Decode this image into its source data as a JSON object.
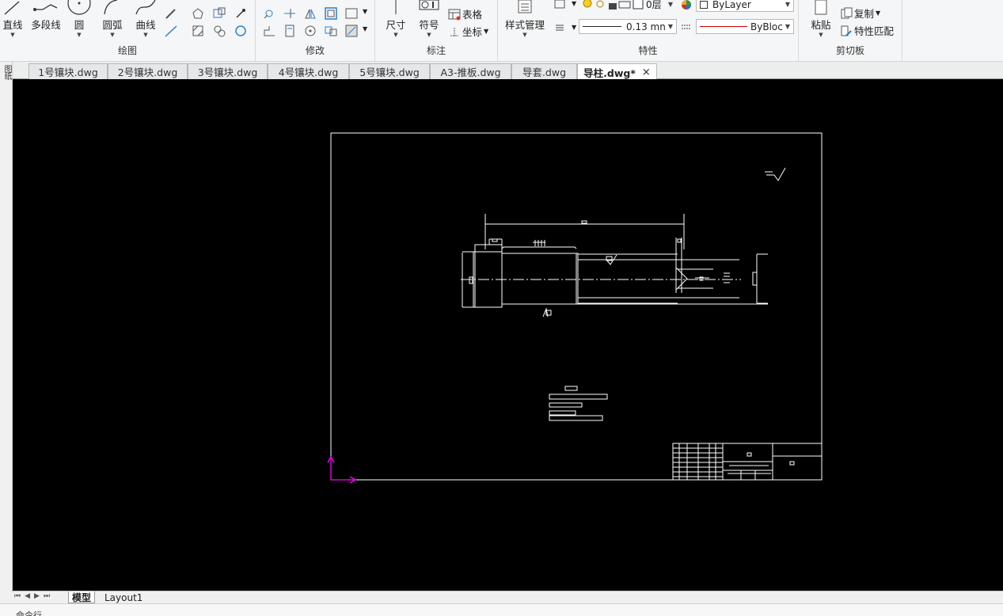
{
  "ribbon": {
    "draw": {
      "title": "绘图",
      "line": "直线",
      "polyline": "多段线",
      "circle": "圆",
      "arc": "圆弧",
      "curve": "曲线"
    },
    "modify": {
      "title": "修改"
    },
    "annotate": {
      "title": "标注",
      "dimension": "尺寸",
      "symbol": "符号",
      "table": "表格",
      "coordinate": "坐标"
    },
    "properties": {
      "title": "特性",
      "style_manager": "样式管理",
      "layer": "0层",
      "color": "ByLayer",
      "lineweight": "0.13 mn",
      "linetype": "ByBloc"
    },
    "clipboard": {
      "title": "剪切板",
      "paste": "粘贴",
      "copy": "复制",
      "match": "特性匹配"
    }
  },
  "left_strip_label": "图纸",
  "tabs": [
    {
      "label": "1号镶块.dwg"
    },
    {
      "label": "2号镶块.dwg"
    },
    {
      "label": "3号镶块.dwg"
    },
    {
      "label": "4号镶块.dwg"
    },
    {
      "label": "5号镶块.dwg"
    },
    {
      "label": "A3-推板.dwg"
    },
    {
      "label": "导套.dwg"
    },
    {
      "label": "导柱.dwg*"
    }
  ],
  "tab_close": "×",
  "layout_tabs": {
    "model": "模型",
    "layout1": "Layout1"
  },
  "nav_arrows": "⏮◀▶⏭",
  "command_prompt": "命令行",
  "colors": {
    "canvas_bg": "#000000",
    "drawing_lines": "#ffffff",
    "ucs_axis": "#ff00ff",
    "linetype_preview": "#cc0000"
  }
}
